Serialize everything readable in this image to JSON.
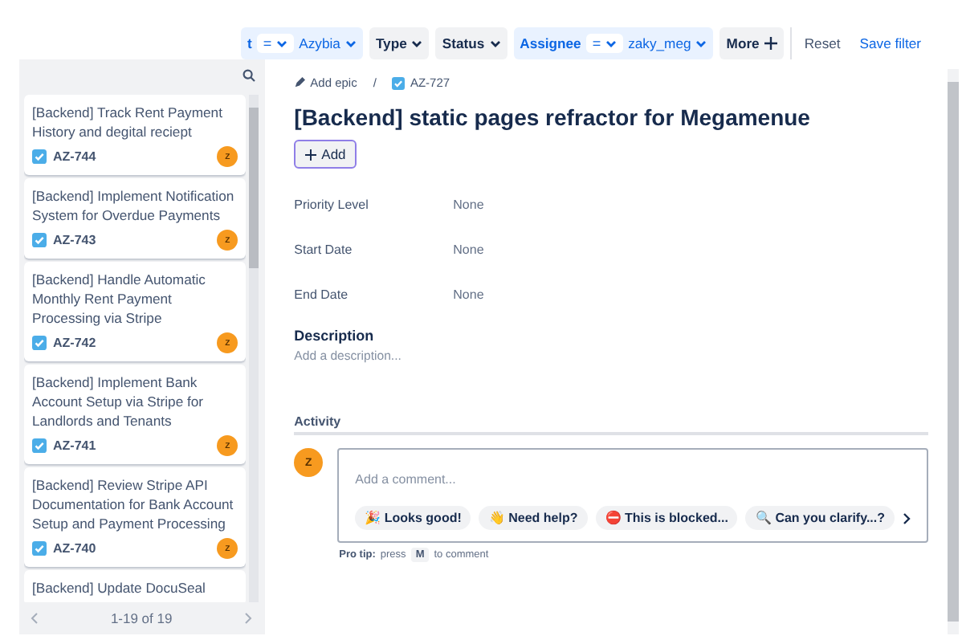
{
  "filters": [
    {
      "kind": "operator",
      "field": "t",
      "operator": "=",
      "value": "Azybia",
      "active": true
    },
    {
      "kind": "dropdown",
      "field": "Type",
      "active": false
    },
    {
      "kind": "dropdown",
      "field": "Status",
      "active": false
    },
    {
      "kind": "operator",
      "field": "Assignee",
      "operator": "=",
      "value": "zaky_meg",
      "active": true
    },
    {
      "kind": "more",
      "field": "More"
    }
  ],
  "filter_actions": {
    "reset": "Reset",
    "save": "Save filter"
  },
  "issues": [
    {
      "title": "[Backend] Track Rent Payment History and degital reciept",
      "key": "AZ-744",
      "assignee": "Z"
    },
    {
      "title": "[Backend] Implement Notification System for Overdue Payments",
      "key": "AZ-743",
      "assignee": "Z"
    },
    {
      "title": "[Backend] Handle Automatic Monthly Rent Payment Processing via Stripe",
      "key": "AZ-742",
      "assignee": "Z"
    },
    {
      "title": "[Backend] Implement Bank Account Setup via Stripe for Landlords and Tenants",
      "key": "AZ-741",
      "assignee": "Z"
    },
    {
      "title": "[Backend] Review Stripe API Documentation for Bank Account Setup and Payment Processing",
      "key": "AZ-740",
      "assignee": "Z"
    },
    {
      "title": "[Backend] Update DocuSeal"
    }
  ],
  "pagination": "1-19 of 19",
  "detail": {
    "breadcrumb": {
      "epic": "Add epic",
      "separator": "/",
      "key": "AZ-727"
    },
    "title": "[Backend] static pages refractor for Megamenue",
    "add_button": "Add",
    "fields": [
      {
        "label": "Priority Level",
        "value": "None"
      },
      {
        "label": "Start Date",
        "value": "None"
      },
      {
        "label": "End Date",
        "value": "None"
      }
    ],
    "description": {
      "heading": "Description",
      "placeholder": "Add a description..."
    },
    "activity": {
      "heading": "Activity",
      "avatar": "Z",
      "placeholder": "Add a comment...",
      "quick_replies": [
        {
          "emoji": "🎉",
          "label": "Looks good!"
        },
        {
          "emoji": "👋",
          "label": "Need help?"
        },
        {
          "emoji": "⛔",
          "label": "This is blocked..."
        },
        {
          "emoji": "🔍",
          "label": "Can you clarify...?"
        }
      ],
      "tip": {
        "lead": "Pro tip:",
        "before": "press",
        "key": "M",
        "after": "to comment"
      }
    }
  }
}
